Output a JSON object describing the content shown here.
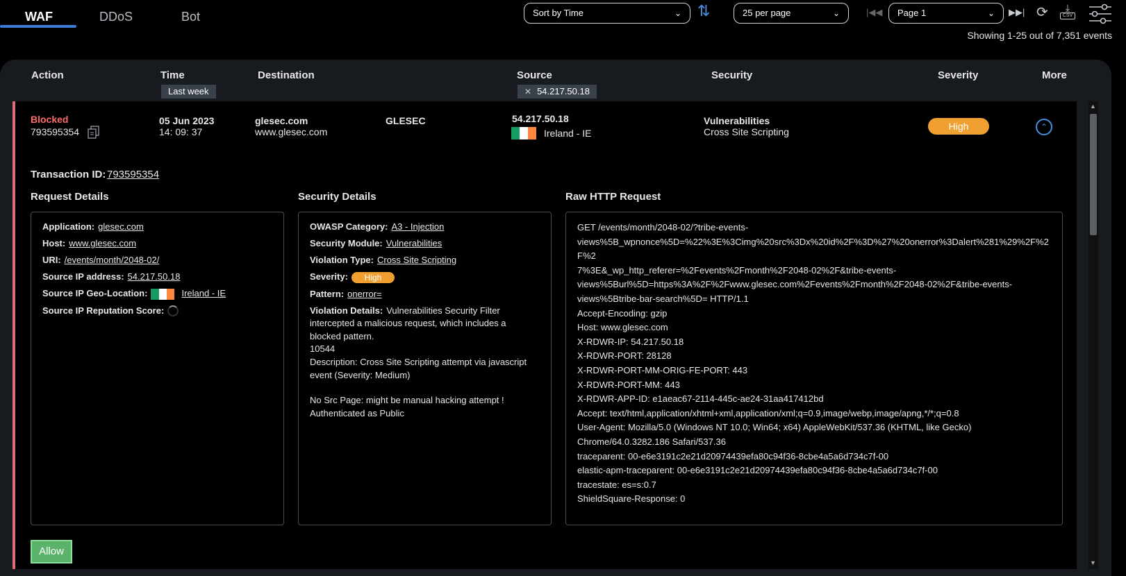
{
  "tabs": [
    "WAF",
    "DDoS",
    "Bot"
  ],
  "toolbar": {
    "sort_value": "Sort by Time",
    "per_page_value": "25 per page",
    "page_value": "Page 1",
    "csv_label": "CSV",
    "showing_text": "Showing 1-25 out of 7,351 events"
  },
  "columns": {
    "action": "Action",
    "time": "Time",
    "destination": "Destination",
    "source": "Source",
    "security": "Security",
    "severity": "Severity",
    "more": "More"
  },
  "filters": {
    "time": "Last week",
    "source": "54.217.50.18"
  },
  "event": {
    "action": "Blocked",
    "id": "793595354",
    "date": "05 Jun 2023",
    "time": "14: 09: 37",
    "dest_app": "glesec.com",
    "dest_host": "www.glesec.com",
    "dest_tenant": "GLESEC",
    "source_ip": "54.217.50.18",
    "source_geo": "Ireland - IE",
    "security_category": "Vulnerabilities",
    "security_type": "Cross Site Scripting",
    "severity": "High"
  },
  "details": {
    "transaction_label": "Transaction ID:",
    "transaction_id": "793595354",
    "request_title": "Request Details",
    "security_title": "Security Details",
    "raw_title": "Raw HTTP Request",
    "request": {
      "application_label": "Application:",
      "application": "glesec.com",
      "host_label": "Host:",
      "host": "www.glesec.com",
      "uri_label": "URI:",
      "uri": "/events/month/2048-02/",
      "source_ip_label": "Source IP address:",
      "source_ip": "54.217.50.18",
      "geo_label": "Source IP Geo-Location:",
      "geo": "Ireland - IE",
      "reputation_label": "Source IP Reputation Score:"
    },
    "security": {
      "owasp_label": "OWASP Category:",
      "owasp": "A3 - Injection",
      "module_label": "Security Module:",
      "module": "Vulnerabilities",
      "violation_type_label": "Violation Type:",
      "violation_type": "Cross Site Scripting",
      "severity_label": "Severity:",
      "severity": "High",
      "pattern_label": "Pattern:",
      "pattern": "onerror=",
      "violation_details_label": "Violation Details:",
      "violation_details_1": "Vulnerabilities Security Filter",
      "violation_details_2": "intercepted a malicious request, which includes a",
      "violation_details_3": "blocked pattern.",
      "code": "10544",
      "description_1": "Description: Cross Site Scripting attempt via javascript",
      "description_2": "event (Severity: Medium)",
      "note_1": "No Src Page: might be manual hacking attempt !",
      "note_2": "Authenticated as Public"
    },
    "raw": [
      "GET /events/month/2048-02/?tribe-events-",
      "views%5B_wpnonce%5D=%22%3E%3Cimg%20src%3Dx%20id%2F%3D%27%20onerror%3Dalert%281%29%2F%2F%2",
      "7%3E&_wp_http_referer=%2Fevents%2Fmonth%2F2048-02%2F&tribe-events-",
      "views%5Burl%5D=https%3A%2F%2Fwww.glesec.com%2Fevents%2Fmonth%2F2048-02%2F&tribe-events-",
      "views%5Btribe-bar-search%5D= HTTP/1.1",
      "Accept-Encoding: gzip",
      "Host: www.glesec.com",
      "X-RDWR-IP: 54.217.50.18",
      "X-RDWR-PORT: 28128",
      "X-RDWR-PORT-MM-ORIG-FE-PORT: 443",
      "X-RDWR-PORT-MM: 443",
      "X-RDWR-APP-ID: e1aeac67-2114-445c-ae24-31aa417412bd",
      "Accept: text/html,application/xhtml+xml,application/xml;q=0.9,image/webp,image/apng,*/*;q=0.8",
      "User-Agent: Mozilla/5.0 (Windows NT 10.0; Win64; x64) AppleWebKit/537.36 (KHTML, like Gecko)",
      "Chrome/64.0.3282.186 Safari/537.36",
      "traceparent: 00-e6e3191c2e21d20974439efa80c94f36-8cbe4a5a6d734c7f-00",
      "elastic-apm-traceparent: 00-e6e3191c2e21d20974439efa80c94f36-8cbe4a5a6d734c7f-00",
      "tracestate: es=s:0.7",
      "ShieldSquare-Response: 0"
    ],
    "allow_label": "Allow"
  },
  "icons": {
    "sort": "sort-arrows-icon",
    "refresh": "refresh-icon",
    "download": "download-csv-icon",
    "filters": "sliders-icon",
    "copy": "copy-icon",
    "collapse": "chevron-up-icon"
  },
  "colors": {
    "accent": "#3d7bd9",
    "blocked": "#ff6b6b",
    "severity_high": "#f0a030",
    "allow": "#5ab26b"
  }
}
